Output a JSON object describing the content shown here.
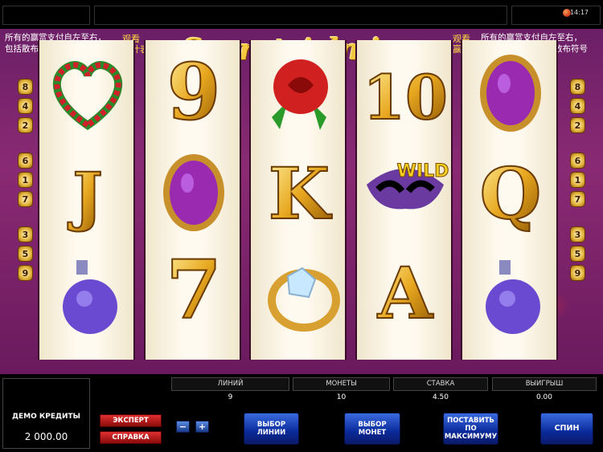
{
  "top_bar": {
    "clock": "14:17"
  },
  "header": {
    "left_text_line1": "所有的赢赏支付自左至右，",
    "left_text_line2": "包括散布符号",
    "left_view_line1": "观看",
    "left_view_line2": "赢计表",
    "logo": "Secret Admirer",
    "right_view_line1": "观看",
    "right_view_line2": "赢计表",
    "right_text_line1": "所有的赢赏支付自左至右，",
    "right_text_line2": "包括散布符号"
  },
  "paylines": {
    "left": [
      "8",
      "4",
      "2",
      "6",
      "1",
      "7",
      "3",
      "5",
      "9"
    ],
    "right": [
      "8",
      "4",
      "2",
      "6",
      "1",
      "7",
      "3",
      "5",
      "9"
    ]
  },
  "reels": [
    [
      "heart",
      "jack",
      "perfume"
    ],
    [
      "nine",
      "amulet",
      "seven"
    ],
    [
      "rose",
      "king",
      "ring"
    ],
    [
      "ten",
      "wild",
      "ace"
    ],
    [
      "amulet",
      "queen",
      "perfume"
    ]
  ],
  "wild_text": "WILD",
  "symbol_letters": {
    "jack": "J",
    "king": "K",
    "queen": "Q",
    "ace": "A",
    "nine": "9",
    "ten": "10",
    "seven": "7"
  },
  "panel": {
    "credits_label": "ДЕМО КРЕДИТЫ",
    "credits_value": "2 000.00",
    "expert_label": "ЭКСПЕРТ",
    "help_label": "СПРАВКА",
    "minus_label": "−",
    "plus_label": "+",
    "lines_label": "ЛИНИЙ",
    "lines_value": "9",
    "coins_label": "МОНЕТЫ",
    "coins_value": "10",
    "bet_label": "СТАВКА",
    "bet_value": "4.50",
    "win_label": "ВЫИГРЫШ",
    "win_value": "0.00",
    "select_lines_l1": "ВЫБОР",
    "select_lines_l2": "ЛИНИИ",
    "select_coins_l1": "ВЫБОР",
    "select_coins_l2": "МОНЕТ",
    "max_bet_l1": "ПОСТАВИТЬ",
    "max_bet_l2": "ПО",
    "max_bet_l3": "МАКСИМУМУ",
    "spin_label": "СПИН"
  },
  "colors": {
    "frame": "#7a2470",
    "gold": "#f5c842",
    "button_blue": "#1a3ab0",
    "button_red": "#c01818"
  }
}
